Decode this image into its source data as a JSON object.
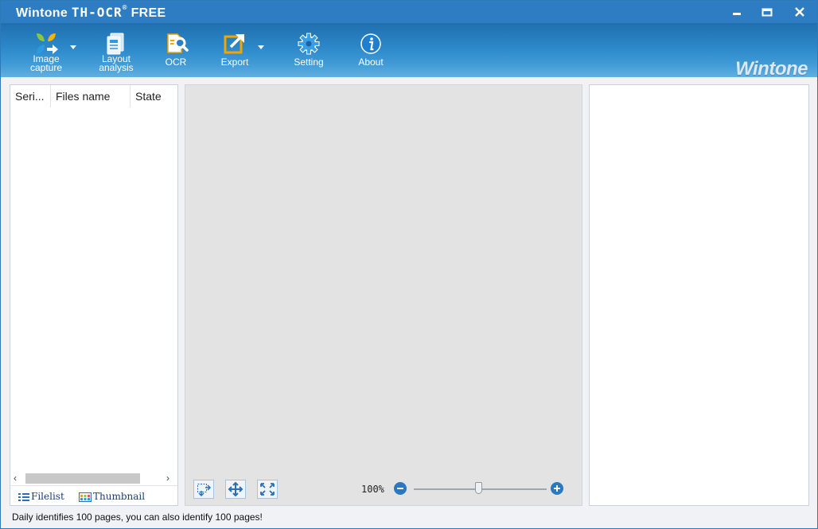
{
  "window": {
    "title_brand": "Wintone",
    "title_product": "TH-OCR",
    "title_registered": "®",
    "title_edition": "FREE"
  },
  "toolbar": {
    "items": [
      {
        "label_line1": "Image",
        "label_line2": "capture",
        "icon": "image-capture-icon",
        "has_dropdown": true
      },
      {
        "label_line1": "Layout",
        "label_line2": "analysis",
        "icon": "layout-analysis-icon",
        "has_dropdown": false
      },
      {
        "label": "OCR",
        "icon": "ocr-icon",
        "has_dropdown": false
      },
      {
        "label": "Export",
        "icon": "export-icon",
        "has_dropdown": true
      },
      {
        "label": "Setting",
        "icon": "gear-icon",
        "has_dropdown": false
      },
      {
        "label": "About",
        "icon": "info-icon",
        "has_dropdown": false
      }
    ],
    "brand_logo": "Wintone"
  },
  "file_list": {
    "columns": [
      "Seri...",
      "Files name",
      "State"
    ],
    "rows": [],
    "tabs": [
      {
        "label": "Filelist",
        "icon": "list-icon"
      },
      {
        "label": "Thumbnail",
        "icon": "thumbnail-icon"
      }
    ]
  },
  "viewer": {
    "zoom_label": "100%",
    "zoom_percent": 100,
    "buttons": [
      "select-region-icon",
      "pan-icon",
      "fit-page-icon"
    ]
  },
  "status_bar": {
    "message": "Daily identifies 100 pages, you can also identify 100 pages!"
  },
  "colors": {
    "titlebar": "#2e7cc1",
    "toolbar_accent": "#2c88c9",
    "zoom_button": "#2a78c2"
  }
}
